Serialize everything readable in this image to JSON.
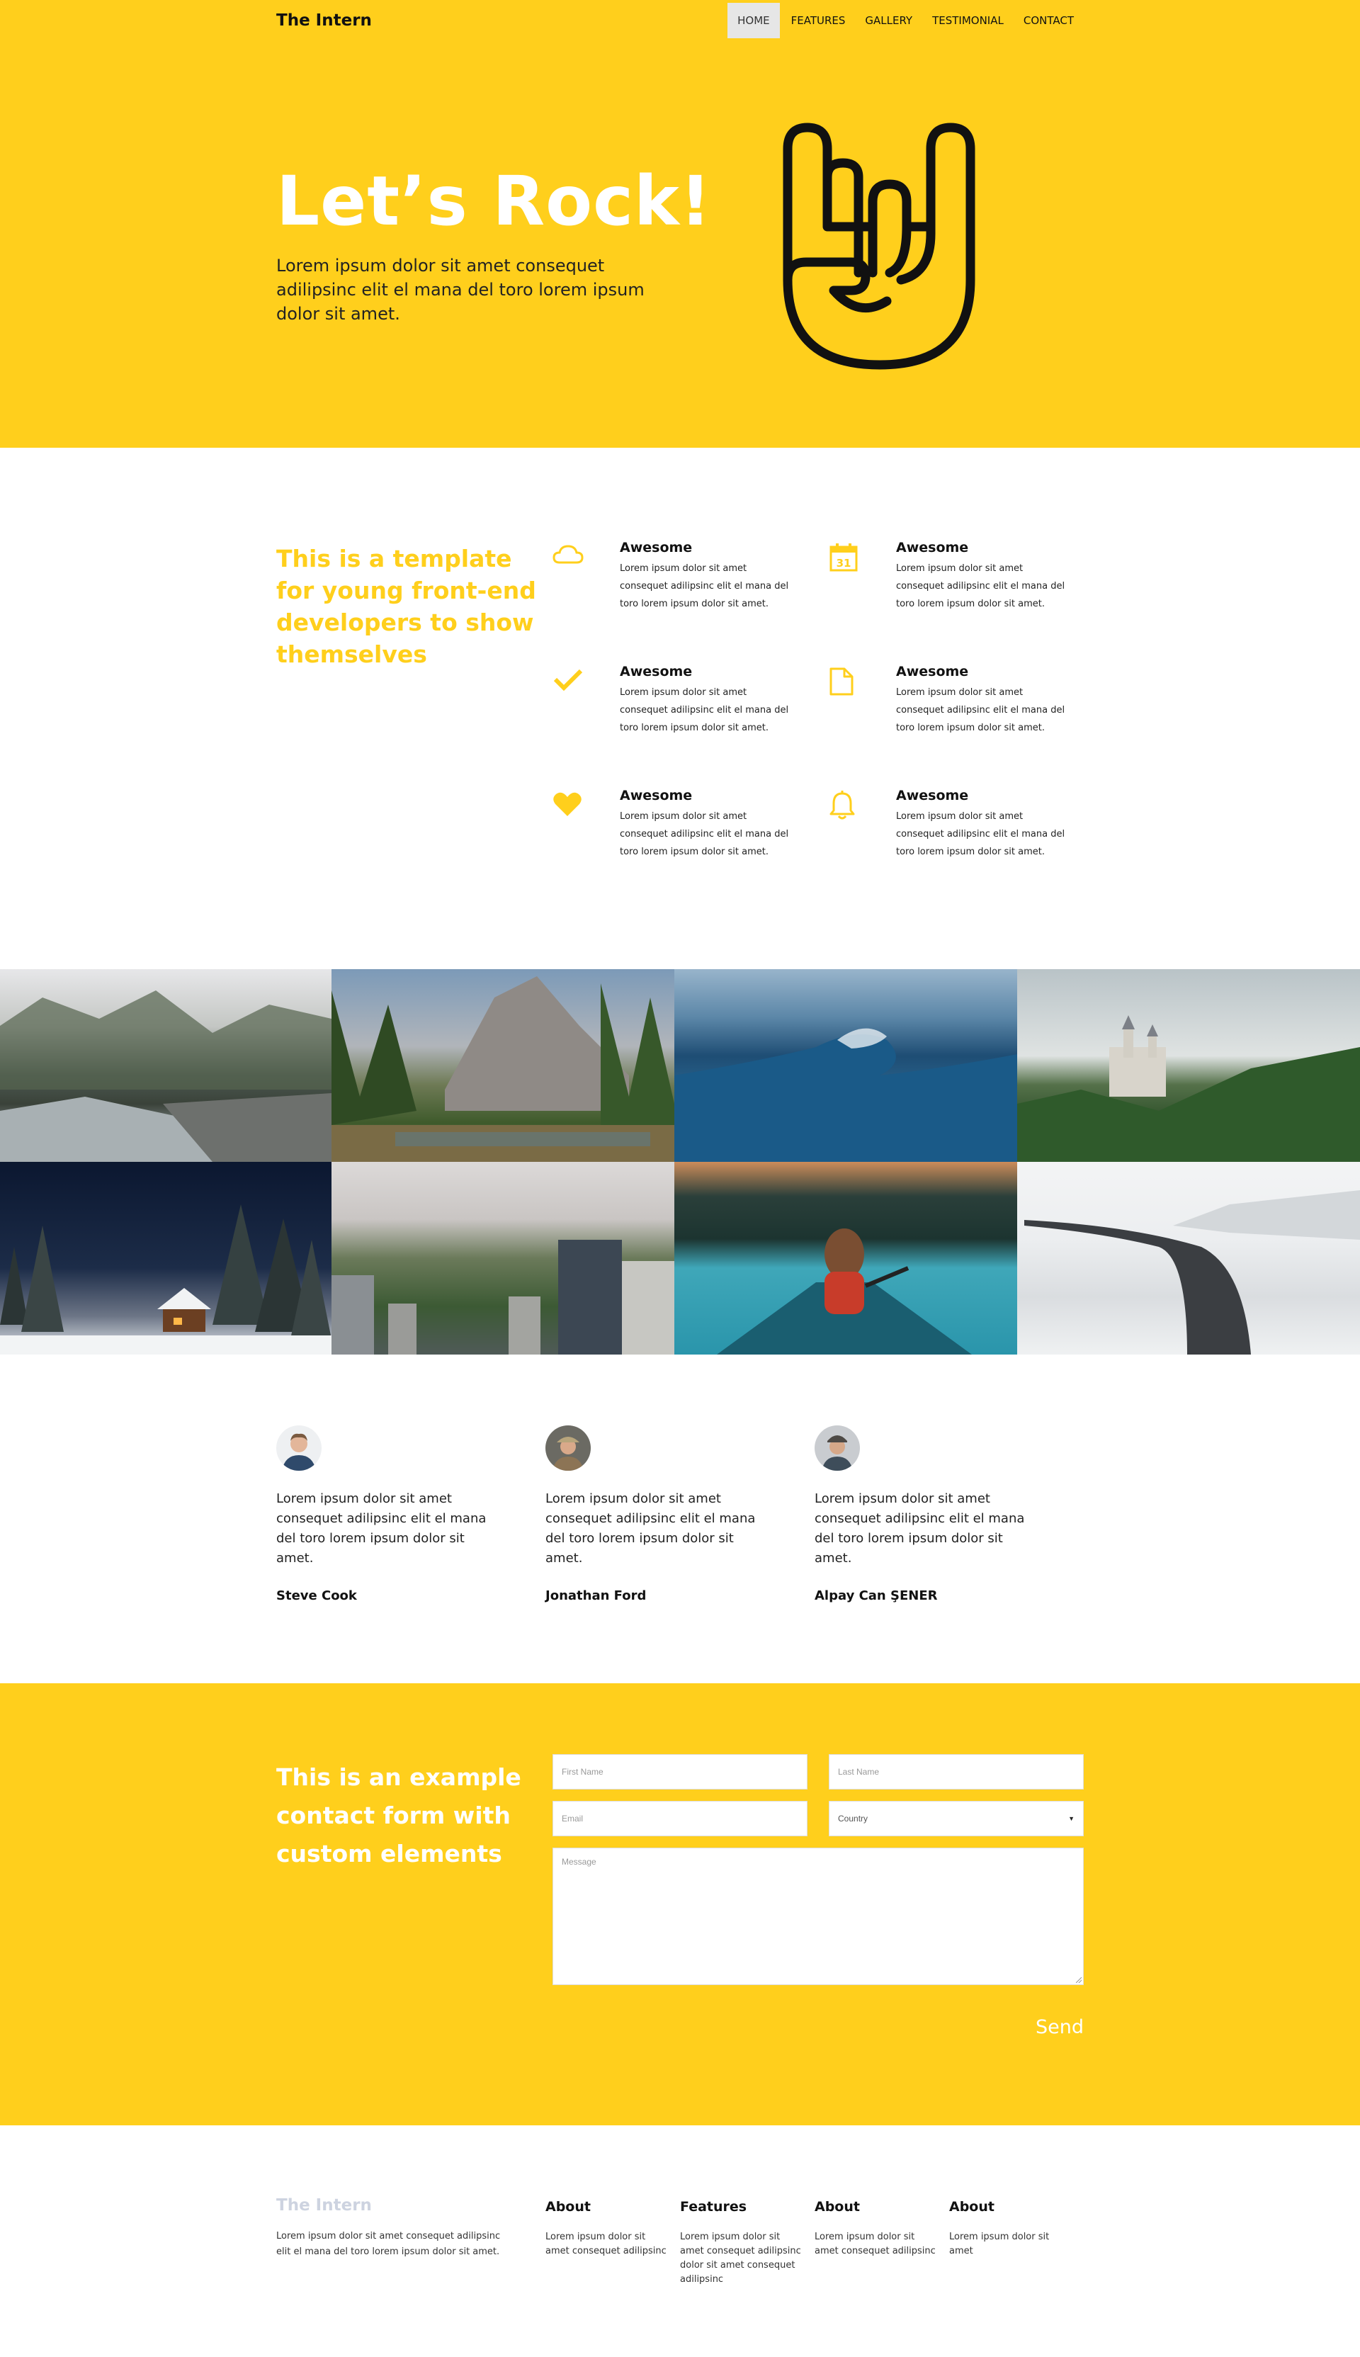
{
  "brand": "The Intern",
  "nav": {
    "items": [
      {
        "label": "HOME"
      },
      {
        "label": "FEATURES"
      },
      {
        "label": "GALLERY"
      },
      {
        "label": "TESTIMONIAL"
      },
      {
        "label": "CONTACT"
      }
    ],
    "active": "HOME"
  },
  "hero": {
    "title": "Let’s Rock!",
    "text": "Lorem ipsum dolor sit amet consequet adilipsinc elit el mana del toro lorem ipsum dolor sit amet.",
    "icon": "rock-hand-icon"
  },
  "features": {
    "title": "This is a template for young front-end developers to show themselves",
    "items": [
      {
        "icon": "cloud-icon",
        "title": "Awesome",
        "text": "Lorem ipsum dolor sit amet consequet adilipsinc elit el mana del toro lorem ipsum dolor sit amet."
      },
      {
        "icon": "calendar-icon",
        "title": "Awesome",
        "text": "Lorem ipsum dolor sit amet consequet adilipsinc elit el mana del toro lorem ipsum dolor sit amet.",
        "badge": "31"
      },
      {
        "icon": "check-icon",
        "title": "Awesome",
        "text": "Lorem ipsum dolor sit amet consequet adilipsinc elit el mana del toro lorem ipsum dolor sit amet."
      },
      {
        "icon": "document-icon",
        "title": "Awesome",
        "text": "Lorem ipsum dolor sit amet consequet adilipsinc elit el mana del toro lorem ipsum dolor sit amet."
      },
      {
        "icon": "heart-icon",
        "title": "Awesome",
        "text": "Lorem ipsum dolor sit amet consequet adilipsinc elit el mana del toro lorem ipsum dolor sit amet."
      },
      {
        "icon": "bell-icon",
        "title": "Awesome",
        "text": "Lorem ipsum dolor sit amet consequet adilipsinc elit el mana del toro lorem ipsum dolor sit amet."
      }
    ]
  },
  "gallery": {
    "images": [
      "foggy-river",
      "mountain-forest",
      "ocean-wave",
      "castle",
      "snowy-cabin",
      "city-park",
      "canoe-lake",
      "snowy-road"
    ]
  },
  "testimonials": [
    {
      "text": "Lorem ipsum dolor sit amet consequet adilipsinc elit el mana del toro lorem ipsum dolor sit amet.",
      "name": "Steve Cook"
    },
    {
      "text": "Lorem ipsum dolor sit amet consequet adilipsinc elit el mana del toro lorem ipsum dolor sit amet.",
      "name": "Jonathan Ford"
    },
    {
      "text": "Lorem ipsum dolor sit amet consequet adilipsinc elit el mana del toro lorem ipsum dolor sit amet.",
      "name": "Alpay Can ŞENER"
    }
  ],
  "contact": {
    "title": "This is an example contact form with custom elements",
    "first_name_placeholder": "First Name",
    "last_name_placeholder": "Last Name",
    "email_placeholder": "Email",
    "country_selected": "Country",
    "message_placeholder": "Message",
    "send_label": "Send"
  },
  "footer": {
    "brand": "The Intern",
    "text": "Lorem ipsum dolor sit amet consequet adilipsinc elit el mana del toro lorem ipsum dolor sit amet.",
    "columns": [
      {
        "title": "About",
        "text": "Lorem ipsum dolor sit amet consequet adilipsinc"
      },
      {
        "title": "Features",
        "text": "Lorem ipsum dolor sit amet consequet adilipsinc dolor sit amet consequet adilipsinc"
      },
      {
        "title": "About",
        "text": "Lorem ipsum dolor sit amet consequet adilipsinc"
      },
      {
        "title": "About",
        "text": "Lorem ipsum dolor sit amet"
      }
    ]
  },
  "colors": {
    "accent": "#ffcf1c",
    "text": "#111111",
    "footer_brand": "#cdd3e0"
  }
}
